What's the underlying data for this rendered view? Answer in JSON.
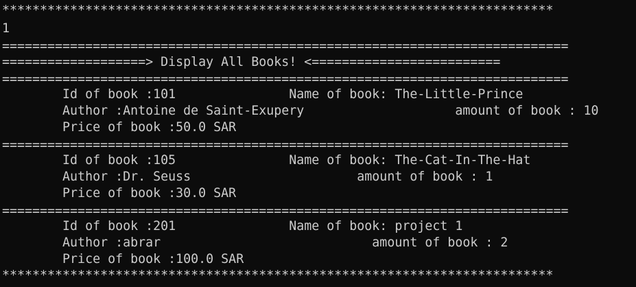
{
  "console": {
    "lines": [
      "*************************************************************************",
      "1",
      "===========================================================================",
      "===================> Display All Books! <=========================",
      "===========================================================================",
      "        Id of book :101               Name of book: The-Little-Prince",
      "        Author :Antoine de Saint-Exupery                    amount of book : 10",
      "        Price of book :50.0 SAR",
      "===========================================================================",
      "        Id of book :105               Name of book: The-Cat-In-The-Hat",
      "        Author :Dr. Seuss                      amount of book : 1",
      "        Price of book :30.0 SAR",
      "===========================================================================",
      "        Id of book :201               Name of book: project 1",
      "        Author :abrar                            amount of book : 2",
      "        Price of book :100.0 SAR",
      "*************************************************************************"
    ]
  },
  "colors": {
    "background": "#0c0c0c",
    "text": "#cccccc"
  }
}
